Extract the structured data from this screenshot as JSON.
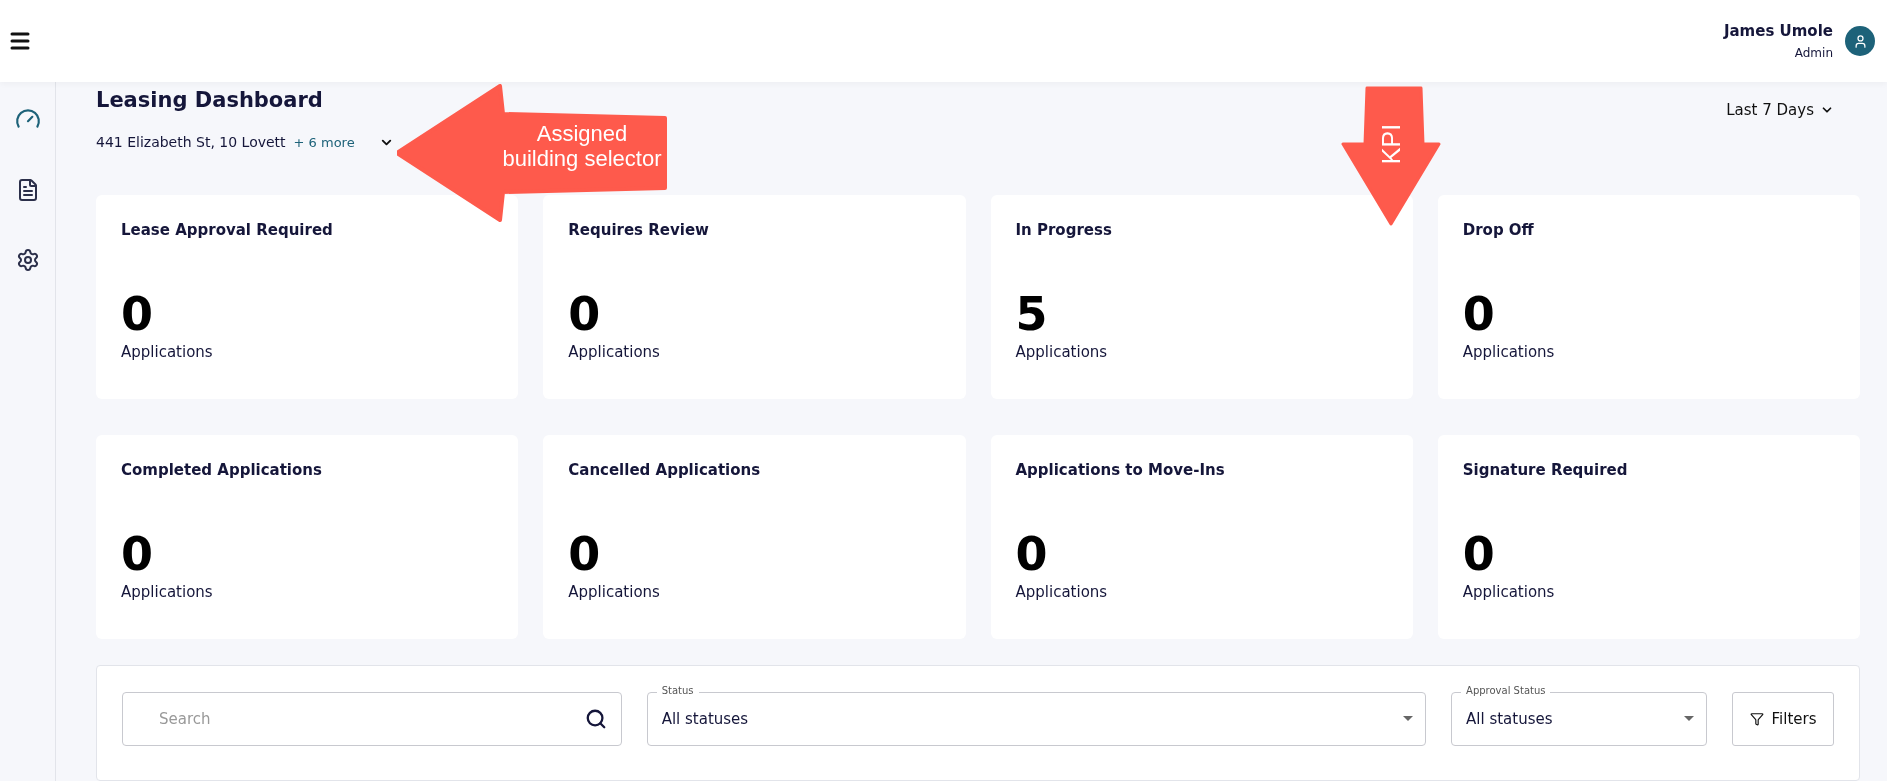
{
  "header": {
    "user_name": "James Umole",
    "user_role": "Admin"
  },
  "sidebar": {
    "items": [
      {
        "kind": "gauge",
        "selected": true
      },
      {
        "kind": "document",
        "selected": false
      },
      {
        "kind": "settings",
        "selected": false
      }
    ]
  },
  "page": {
    "title": "Leasing Dashboard",
    "buildings": "441 Elizabeth St, 10 Lovett",
    "more": "+ 6 more",
    "period": "Last 7 Days"
  },
  "kpis": [
    {
      "title": "Lease Approval Required",
      "value": "0",
      "unit": "Applications"
    },
    {
      "title": "Requires Review",
      "value": "0",
      "unit": "Applications"
    },
    {
      "title": "In Progress",
      "value": "5",
      "unit": "Applications"
    },
    {
      "title": "Drop Off",
      "value": "0",
      "unit": "Applications"
    },
    {
      "title": "Completed Applications",
      "value": "0",
      "unit": "Applications"
    },
    {
      "title": "Cancelled Applications",
      "value": "0",
      "unit": "Applications"
    },
    {
      "title": "Applications to Move-Ins",
      "value": "0",
      "unit": "Applications"
    },
    {
      "title": "Signature Required",
      "value": "0",
      "unit": "Applications"
    }
  ],
  "filters": {
    "search": {
      "placeholder": "Search"
    },
    "selects": [
      {
        "label": "Status",
        "value": "All statuses"
      },
      {
        "label": "Approval Status",
        "value": "All statuses"
      }
    ],
    "button": "Filters"
  },
  "annotations": [
    {
      "kind": "left",
      "text": "Assigned building selector"
    },
    {
      "kind": "down",
      "text": "KPI"
    }
  ]
}
